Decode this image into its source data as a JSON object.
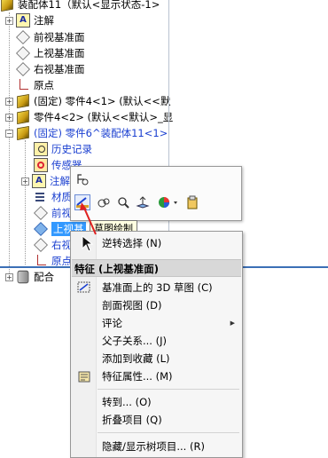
{
  "tree": {
    "nodes": [
      {
        "label": "装配体11（默认<显示状态-1>",
        "icon": "assembly-icon"
      },
      {
        "label": "注解",
        "icon": "annotation-icon"
      },
      {
        "label": "前视基准面",
        "icon": "plane-icon"
      },
      {
        "label": "上视基准面",
        "icon": "plane-icon"
      },
      {
        "label": "右视基准面",
        "icon": "plane-icon"
      },
      {
        "label": "原点",
        "icon": "origin-icon"
      },
      {
        "label": "(固定) 零件4<1> (默认<<默",
        "icon": "part-icon"
      },
      {
        "label": "零件4<2> (默认<<默认>_显",
        "icon": "part-icon"
      },
      {
        "label": "(固定) 零件6^装配体11<1>",
        "icon": "part-icon"
      },
      {
        "label": "历史记录",
        "icon": "history-icon"
      },
      {
        "label": "传感器",
        "icon": "sensor-icon"
      },
      {
        "label": "注解",
        "icon": "annotation-icon"
      },
      {
        "label": "材质",
        "icon": "material-icon"
      },
      {
        "label": "前视",
        "icon": "plane-icon"
      },
      {
        "label": "上视基",
        "icon": "plane-icon"
      },
      {
        "label": "右视",
        "icon": "plane-icon"
      },
      {
        "label": "原点",
        "icon": "origin-icon"
      },
      {
        "label": "配合",
        "icon": "mates-icon"
      }
    ]
  },
  "minibar": {
    "tooltip": "草图绘制",
    "icons": [
      "smart-dimension-icon",
      "sketch-icon",
      "view-orientation-icon",
      "zoom-icon",
      "normal-to-icon",
      "appearance-icon",
      "paste-icon"
    ]
  },
  "context_menu": {
    "reverse_select": "逆转选择 (N)",
    "header": "特征 (上视基准面)",
    "items": [
      {
        "label": "基准面上的 3D 草图 (C)",
        "icon": "3d-sketch-icon"
      },
      {
        "label": "剖面视图 (D)"
      },
      {
        "label": "评论",
        "submenu": true
      },
      {
        "label": "父子关系... (J)"
      },
      {
        "label": "添加到收藏 (L)"
      },
      {
        "label": "特征属性... (M)",
        "icon": "feature-properties-icon"
      },
      {
        "label": "转到... (O)"
      },
      {
        "label": "折叠项目 (Q)"
      },
      {
        "label": "隐藏/显示树项目... (R)"
      }
    ]
  },
  "colors": {
    "selection": "#3399ff",
    "part_blue": "#1a3fd0",
    "arrow": "#e02020"
  }
}
